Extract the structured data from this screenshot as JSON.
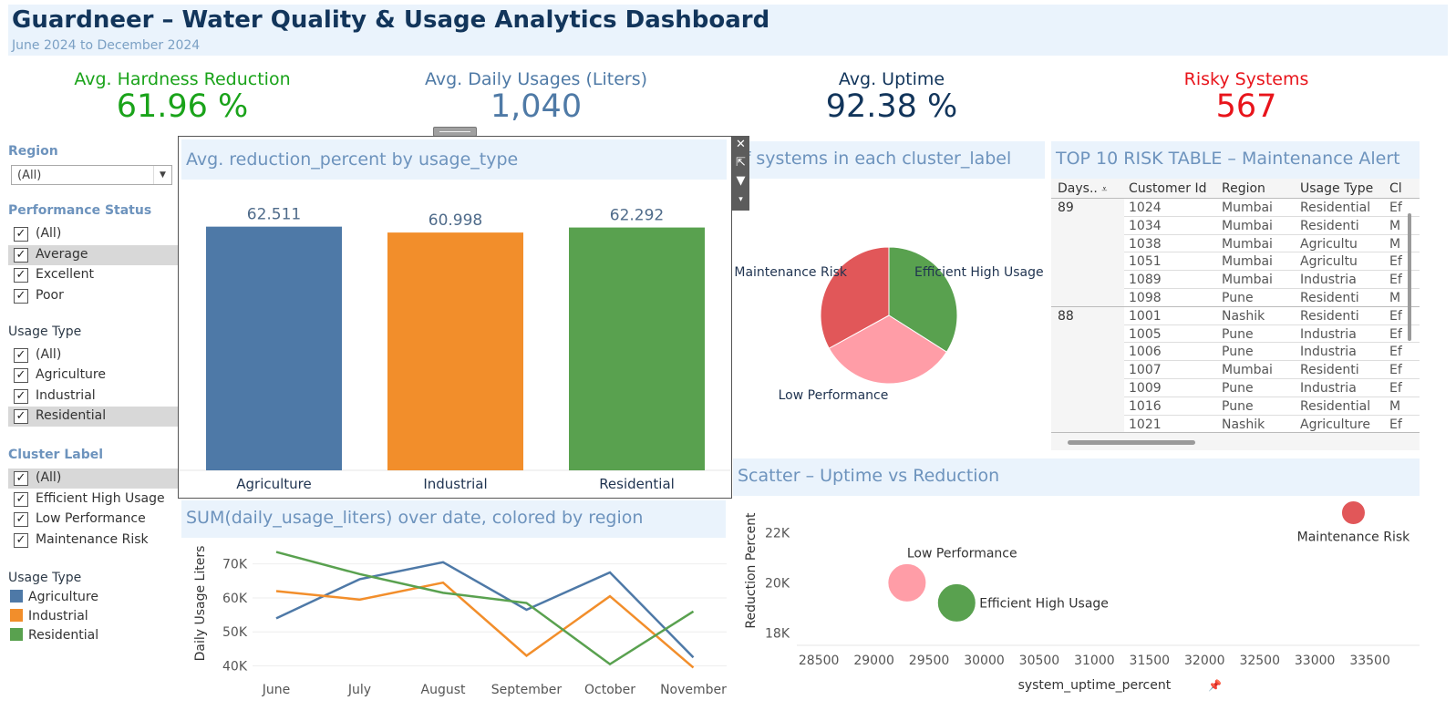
{
  "header": {
    "title": "Guardneer – Water Quality & Usage Analytics Dashboard",
    "subtitle": "June 2024 to December 2024"
  },
  "kpis": [
    {
      "label": "Avg. Hardness Reduction",
      "value": "61.96 %",
      "color": "#1aa31a"
    },
    {
      "label": "Avg. Daily Usages (Liters)",
      "value": "1,040",
      "color": "#4f7aa6"
    },
    {
      "label": "Avg. Uptime",
      "value": "92.38 %",
      "color": "#12355b"
    },
    {
      "label": "Risky Systems",
      "value": "567",
      "color": "#e8141b"
    }
  ],
  "filters": {
    "region": {
      "title": "Region",
      "value": "(All)"
    },
    "performance": {
      "title": "Performance Status",
      "items": [
        "(All)",
        "Average",
        "Excellent",
        "Poor"
      ]
    },
    "usage": {
      "title": "Usage Type",
      "items": [
        "(All)",
        "Agriculture",
        "Industrial",
        "Residential"
      ]
    },
    "cluster": {
      "title": "Cluster Label",
      "items": [
        "(All)",
        "Efficient High Usage",
        "Low Performance",
        "Maintenance Risk"
      ]
    },
    "legend": {
      "title": "Usage Type",
      "items": [
        "Agriculture",
        "Industrial",
        "Residential"
      ]
    }
  },
  "colors": {
    "agriculture": "#4e79a7",
    "industrial": "#f28e2b",
    "residential": "#59a14f",
    "risk": "#e15759",
    "lowperf": "#ff9da7"
  },
  "toolstrip": {
    "icons": [
      "close-icon",
      "popout-icon",
      "filter-icon",
      "more-icon"
    ]
  },
  "bar_panel": {
    "title": "Avg. reduction_percent by usage_type"
  },
  "pie_panel": {
    "title": "# of systems in each cluster_label",
    "title_visible": "of systems in each cluster_label"
  },
  "table_panel": {
    "title": "TOP 10 RISK TABLE – Maintenance Alert",
    "columns": [
      "Days..",
      "Customer Id",
      "Region",
      "Usage Type",
      "Cl"
    ],
    "groups": [
      {
        "days": "89",
        "rows": [
          [
            "1024",
            "Mumbai",
            "Residential",
            "Ef"
          ],
          [
            "1034",
            "Mumbai",
            "Residenti",
            "M"
          ],
          [
            "1038",
            "Mumbai",
            "Agricultu",
            "M"
          ],
          [
            "1051",
            "Mumbai",
            "Agricultu",
            "Ef"
          ],
          [
            "1089",
            "Mumbai",
            "Industria",
            "Ef"
          ],
          [
            "1098",
            "Pune",
            "Residenti",
            "M"
          ]
        ]
      },
      {
        "days": "88",
        "rows": [
          [
            "1001",
            "Nashik",
            "Residenti",
            "Ef"
          ],
          [
            "1005",
            "Pune",
            "Industria",
            "Ef"
          ],
          [
            "1006",
            "Pune",
            "Industria",
            "Ef"
          ],
          [
            "1007",
            "Mumbai",
            "Residenti",
            "Ef"
          ],
          [
            "1009",
            "Pune",
            "Industria",
            "Ef"
          ],
          [
            "1016",
            "Pune",
            "Residential",
            "M"
          ],
          [
            "1021",
            "Nashik",
            "Agriculture",
            "Ef"
          ]
        ]
      }
    ]
  },
  "line_panel": {
    "title": "SUM(daily_usage_liters) over date, colored by region"
  },
  "scatter_panel": {
    "title": "Scatter – Uptime vs Reduction"
  },
  "chart_data": [
    {
      "type": "bar",
      "title": "Avg. reduction_percent by usage_type",
      "categories": [
        "Agriculture",
        "Industrial",
        "Residential"
      ],
      "values": [
        62.511,
        60.998,
        62.292
      ],
      "labels": [
        "62.511",
        "60.998",
        "62.292"
      ],
      "ylim": [
        0,
        65
      ]
    },
    {
      "type": "pie",
      "title": "# of systems in each cluster_label",
      "categories": [
        "Efficient High Usage",
        "Low Performance",
        "Maintenance Risk"
      ],
      "values": [
        34,
        33,
        33
      ]
    },
    {
      "type": "line",
      "title": "SUM(daily_usage_liters) over date, colored by region",
      "x": [
        "June",
        "July",
        "August",
        "September",
        "October",
        "November"
      ],
      "ylabel": "Daily Usage Liters",
      "ylim": [
        38000,
        75000
      ],
      "yticks": [
        40000,
        50000,
        60000,
        70000
      ],
      "ytick_labels": [
        "40K",
        "50K",
        "60K",
        "70K"
      ],
      "series": [
        {
          "values": [
            54000,
            65500,
            70500,
            56500,
            67500,
            42500
          ]
        },
        {
          "values": [
            62000,
            59500,
            64500,
            43000,
            60500,
            39500
          ]
        },
        {
          "values": [
            73500,
            67000,
            61500,
            58500,
            40500,
            56000
          ]
        }
      ]
    },
    {
      "type": "scatter",
      "title": "Scatter – Uptime vs Reduction",
      "xlabel": "system_uptime_percent",
      "ylabel": "Reduction Percent",
      "xlim": [
        28300,
        33950
      ],
      "ylim": [
        17500,
        23400
      ],
      "xticks": [
        28500,
        29000,
        29500,
        30000,
        30500,
        31000,
        31500,
        32000,
        32500,
        33000,
        33500
      ],
      "yticks": [
        18000,
        20000,
        22000
      ],
      "ytick_labels": [
        "18K",
        "20K",
        "22K"
      ],
      "points": [
        {
          "label": "Low Performance",
          "x": 29300,
          "y": 20000,
          "size": 3
        },
        {
          "label": "Efficient High Usage",
          "x": 29750,
          "y": 19200,
          "size": 3
        },
        {
          "label": "Maintenance Risk",
          "x": 33350,
          "y": 22800,
          "size": 1
        }
      ]
    }
  ]
}
